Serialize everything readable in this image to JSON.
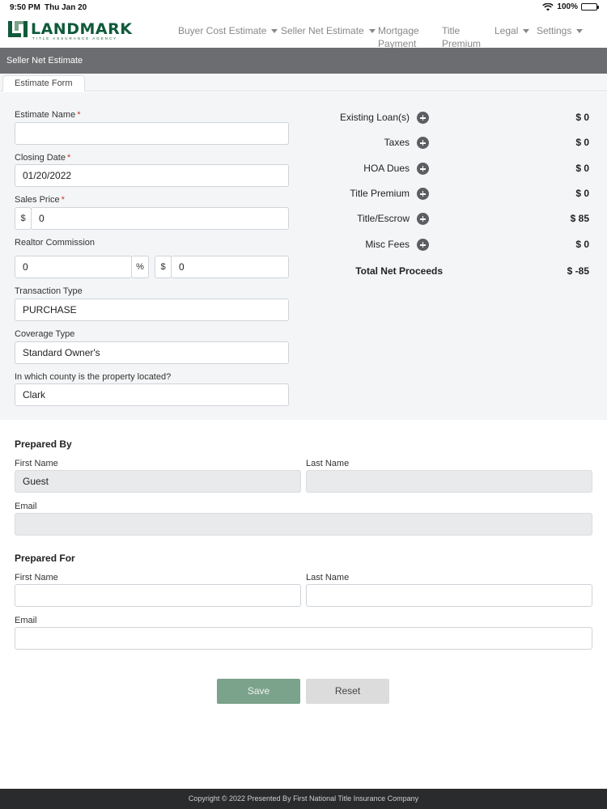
{
  "status_bar": {
    "time": "9:50 PM",
    "date": "Thu Jan 20",
    "battery": "100%"
  },
  "brand": {
    "name": "LANDMARK",
    "tagline": "TITLE ASSURANCE AGENCY",
    "color": "#0f5a3a"
  },
  "nav": {
    "items": [
      {
        "label": "Buyer Cost Estimate",
        "dropdown": true
      },
      {
        "label": "Seller Net Estimate",
        "dropdown": true
      },
      {
        "label": "Mortgage Payment",
        "dropdown": false
      },
      {
        "label": "Title Premium",
        "dropdown": false
      },
      {
        "label": "Legal",
        "dropdown": true
      },
      {
        "label": "Settings",
        "dropdown": true
      }
    ]
  },
  "page": {
    "title": "Seller Net Estimate",
    "tab": "Estimate Form"
  },
  "form": {
    "estimate_name": {
      "label": "Estimate Name",
      "value": ""
    },
    "closing_date": {
      "label": "Closing Date",
      "value": "01/20/2022"
    },
    "sales_price": {
      "label": "Sales Price",
      "prefix": "$",
      "value": "0"
    },
    "realtor_commission": {
      "label": "Realtor Commission",
      "percent_value": "0",
      "percent_suffix": "%",
      "amount_prefix": "$",
      "amount_value": "0"
    },
    "transaction_type": {
      "label": "Transaction Type",
      "value": "PURCHASE"
    },
    "coverage_type": {
      "label": "Coverage Type",
      "value": "Standard Owner's"
    },
    "county": {
      "label": "In which county is the property located?",
      "value": "Clark"
    },
    "required_mark": "*"
  },
  "costs": {
    "rows": [
      {
        "label": "Existing Loan(s)",
        "value": "$ 0"
      },
      {
        "label": "Taxes",
        "value": "$ 0"
      },
      {
        "label": "HOA Dues",
        "value": "$ 0"
      },
      {
        "label": "Title Premium",
        "value": "$ 0"
      },
      {
        "label": "Title/Escrow",
        "value": "$ 85"
      },
      {
        "label": "Misc Fees",
        "value": "$ 0"
      }
    ],
    "total": {
      "label": "Total Net Proceeds",
      "value": "$ -85"
    }
  },
  "prepared_by": {
    "title": "Prepared By",
    "first_name_label": "First Name",
    "first_name": "Guest",
    "last_name_label": "Last Name",
    "last_name": "",
    "email_label": "Email",
    "email": ""
  },
  "prepared_for": {
    "title": "Prepared For",
    "first_name_label": "First Name",
    "first_name": "",
    "last_name_label": "Last Name",
    "last_name": "",
    "email_label": "Email",
    "email": ""
  },
  "actions": {
    "save": "Save",
    "reset": "Reset",
    "save_color": "#7ba28a"
  },
  "footer": {
    "text": "Copyright © 2022 Presented By First National Title Insurance Company"
  }
}
